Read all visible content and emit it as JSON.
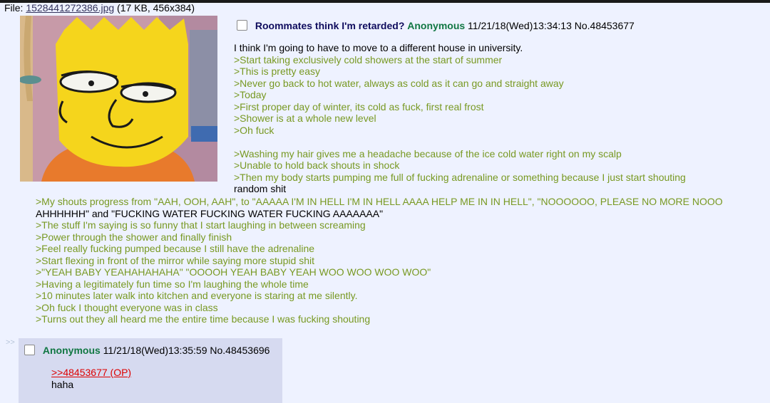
{
  "file": {
    "label": "File:",
    "name": "1528441272386.jpg",
    "meta": "(17 KB, 456x384)"
  },
  "op": {
    "subject": "Roommates think I'm retarded?",
    "name": "Anonymous",
    "datetime": "11/21/18(Wed)13:34:13",
    "post_no": "No.48453677",
    "lines_narrow": [
      "I think I'm going to have to move to a different house in university.",
      ">Start taking exclusively cold showers at the start of summer",
      ">This is pretty easy",
      ">Never go back to hot water, always as cold as it can go and straight away",
      ">Today",
      ">First proper day of winter, its cold as fuck, first real frost",
      ">Shower is at a whole new level",
      ">Oh fuck",
      "",
      ">Washing my hair gives me a headache because of the ice cold water right on my scalp",
      ">Unable to hold back shouts in shock",
      ">Then my body starts pumping me full of fucking adrenaline or something because I just start shouting",
      "random shit"
    ],
    "lines_wide": [
      ">My shouts progress from \"AAH, OOH, AAH\", to \"AAAAA I'M IN HELL I'M IN HELL AAAA HELP ME IN IN HELL\", \"NOOOOOO, PLEASE NO MORE NOOO",
      "AHHHHHH\" and \"FUCKING WATER FUCKING WATER FUCKING AAAAAAA\"",
      ">The stuff I'm saying is so funny that I start laughing in between screaming",
      ">Power through the shower and finally finish",
      ">Feel really fucking pumped because I still have the adrenaline",
      ">Start flexing in front of the mirror while saying more stupid shit",
      ">\"YEAH BABY YEAHAHAHAHA\" \"OOOOH YEAH BABY YEAH WOO WOO WOO WOO\"",
      ">Having a legitimately fun time so I'm laughing the whole time",
      ">10 minutes later walk into kitchen and everyone is staring at me silently.",
      ">Oh fuck I thought everyone was in class",
      ">Turns out they all heard me the entire time because I was fucking shouting"
    ]
  },
  "reply": {
    "arrows": ">>",
    "name": "Anonymous",
    "datetime": "11/21/18(Wed)13:35:59",
    "post_no": "No.48453696",
    "quote_link": ">>48453677 (OP)",
    "text": "haha"
  },
  "colors": {
    "background": "#eef2ff",
    "reply_background": "#d6daf0",
    "greentext": "#789922",
    "name": "#117743",
    "subject": "#0f0c5d",
    "quote_link": "#dd0000"
  }
}
